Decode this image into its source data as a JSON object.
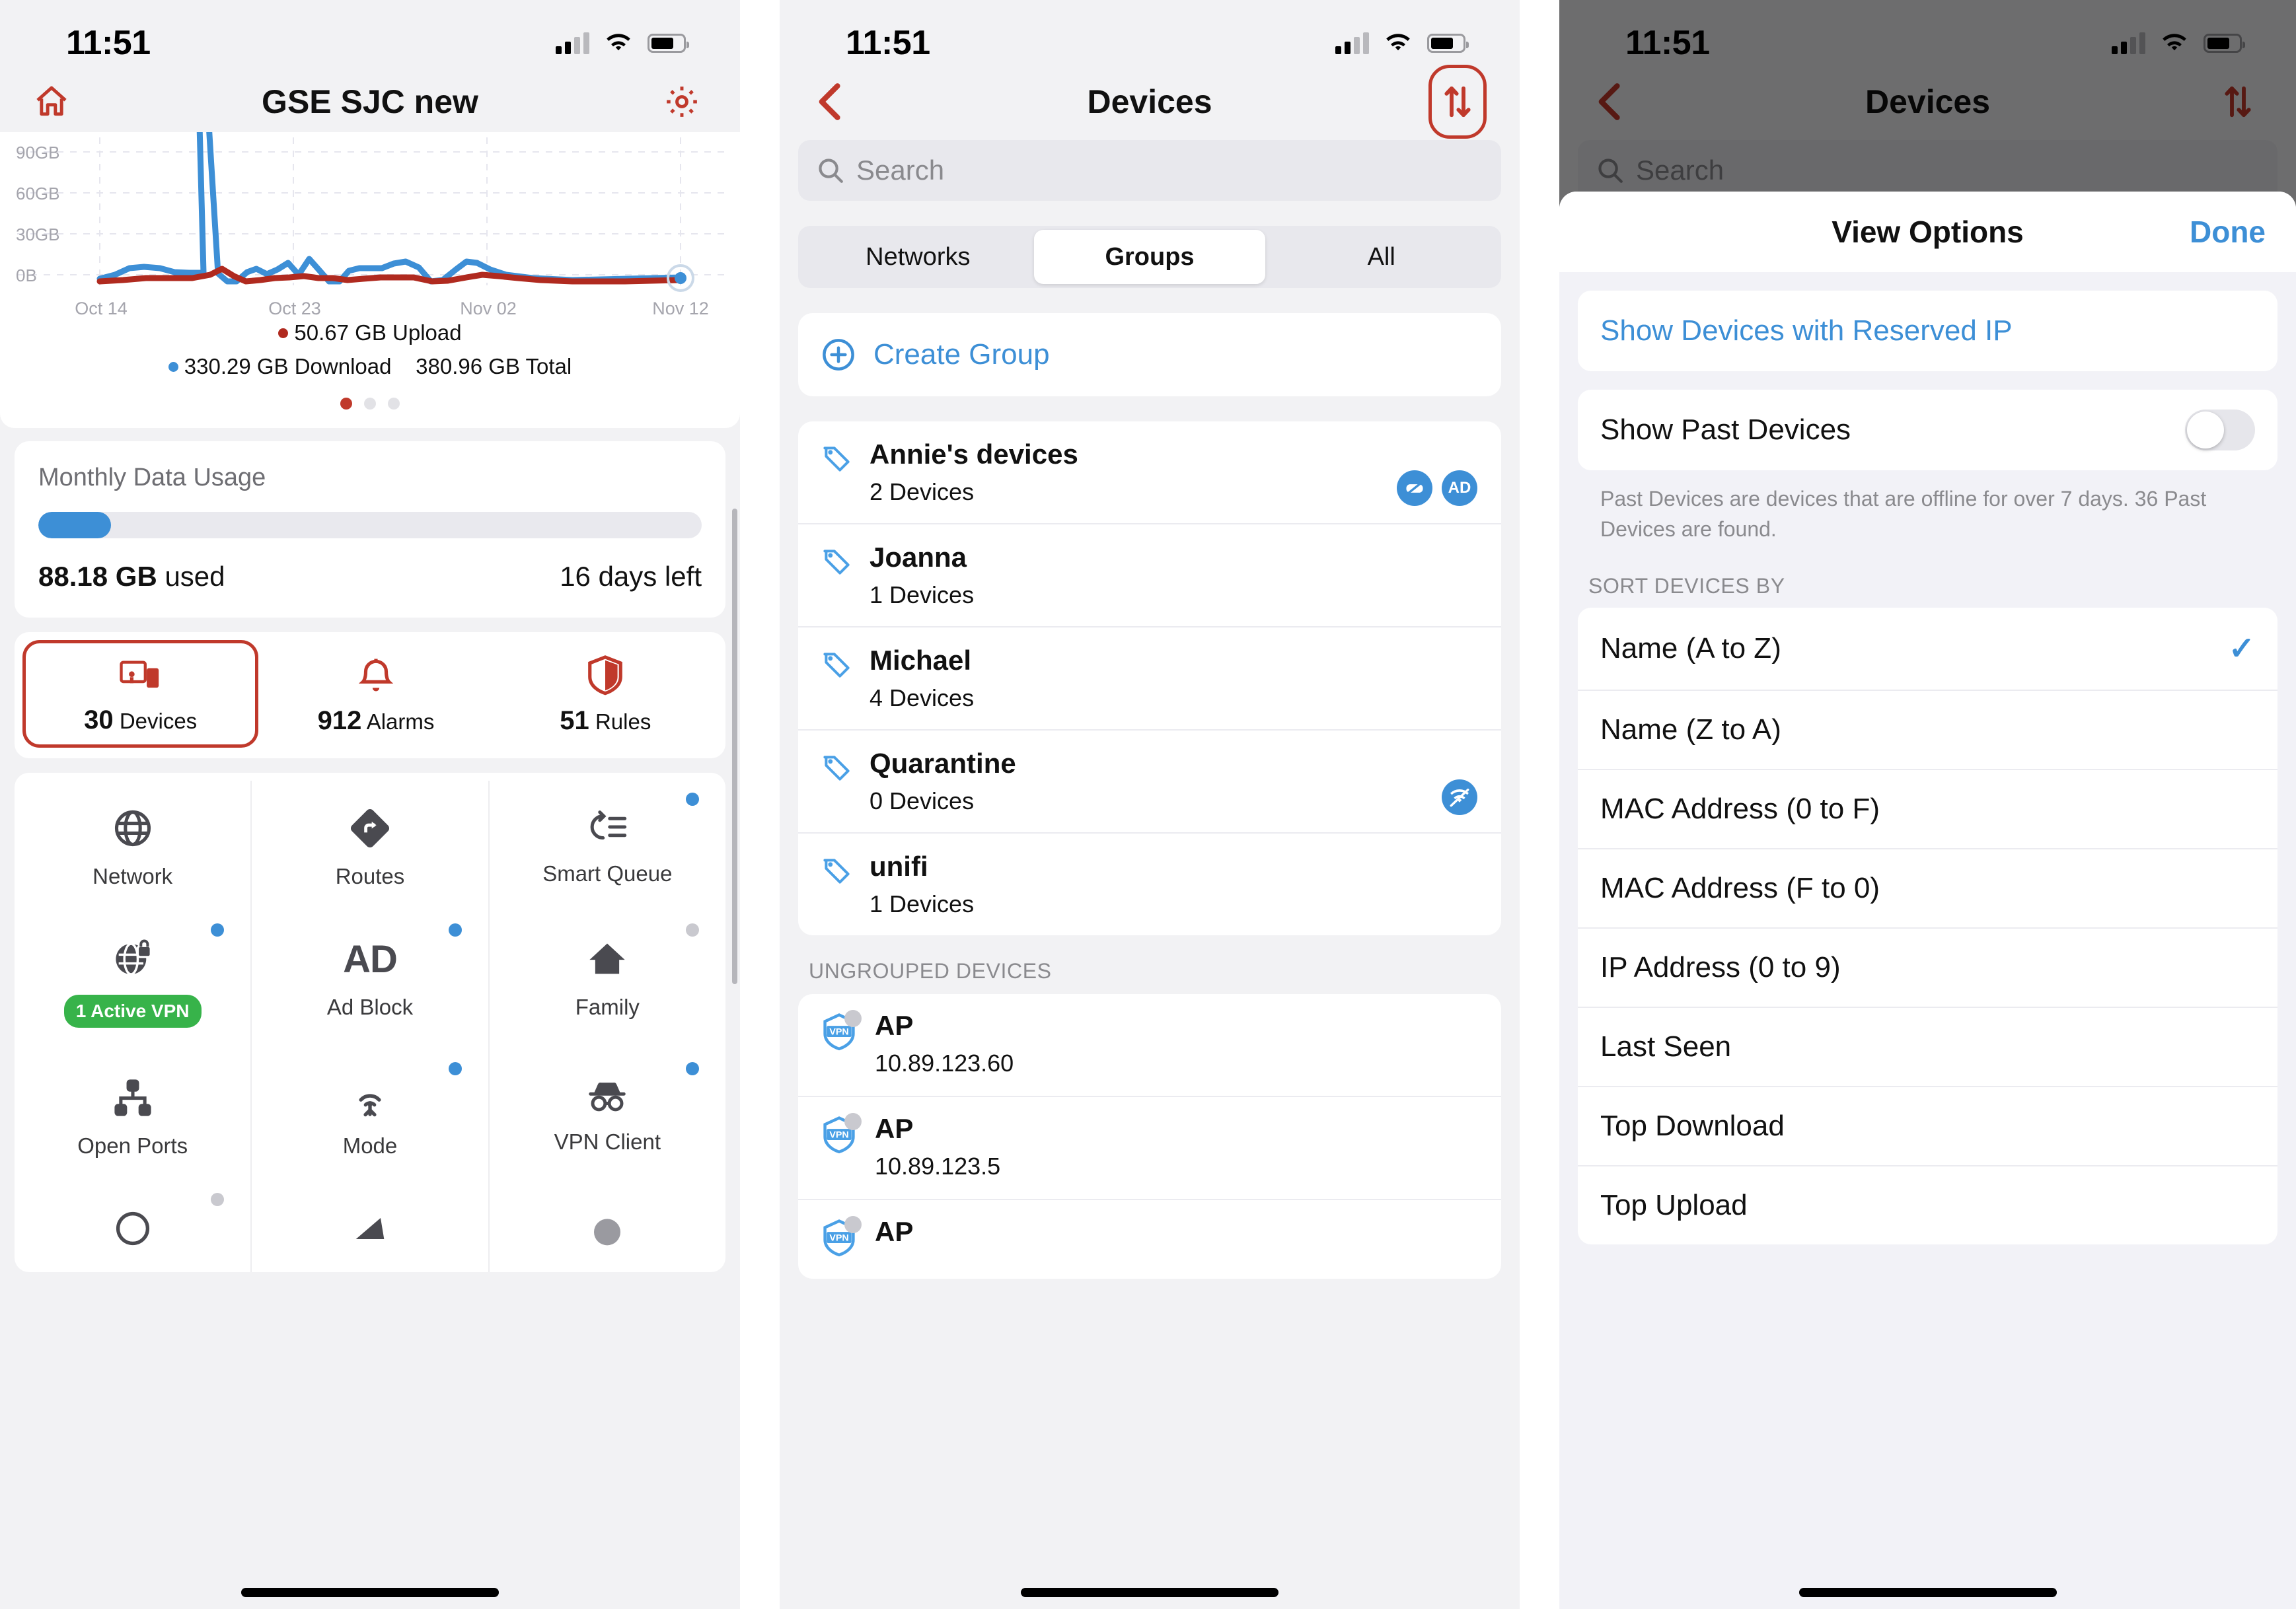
{
  "status_bar": {
    "time": "11:51"
  },
  "panel1": {
    "nav": {
      "home_icon": "home-icon",
      "title": "GSE SJC new",
      "settings_icon": "gear-icon"
    },
    "chart_card": {
      "legend_upload": "50.67 GB Upload",
      "legend_download": "330.29 GB Download",
      "legend_total": "380.96 GB Total",
      "pager_count": 3,
      "pager_active": 0
    },
    "usage": {
      "title": "Monthly Data Usage",
      "used_value": "88.18 GB",
      "used_suffix": "used",
      "days_left": "16 days left",
      "percent": 11
    },
    "stats": [
      {
        "value": "30",
        "label": "Devices",
        "icon": "devices-icon",
        "selected": true
      },
      {
        "value": "912",
        "label": "Alarms",
        "icon": "bell-icon",
        "selected": false
      },
      {
        "value": "51",
        "label": "Rules",
        "icon": "shield-icon",
        "selected": false
      }
    ],
    "grid": [
      {
        "label": "Network",
        "icon": "globe-icon",
        "badge": "none"
      },
      {
        "label": "Routes",
        "icon": "routes-icon",
        "badge": "none"
      },
      {
        "label": "Smart Queue",
        "icon": "smart-queue-icon",
        "badge": "blue"
      },
      {
        "label": "1 Active VPN",
        "icon": "vpn-server-icon",
        "badge": "blue",
        "pill": true
      },
      {
        "label": "Ad Block",
        "icon": "ad-icon",
        "badge": "blue"
      },
      {
        "label": "Family",
        "icon": "home-filled-icon",
        "badge": "grey"
      },
      {
        "label": "Open Ports",
        "icon": "open-ports-icon",
        "badge": "none"
      },
      {
        "label": "Mode",
        "icon": "antenna-icon",
        "badge": "blue"
      },
      {
        "label": "VPN Client",
        "icon": "incognito-icon",
        "badge": "blue"
      }
    ]
  },
  "panel2": {
    "nav": {
      "back_icon": "chevron-left-icon",
      "title": "Devices",
      "sort_icon": "sort-updown-icon"
    },
    "search": {
      "placeholder": "Search",
      "value": "",
      "icon": "search-icon"
    },
    "segments": [
      {
        "label": "Networks",
        "selected": false
      },
      {
        "label": "Groups",
        "selected": true
      },
      {
        "label": "All",
        "selected": false
      }
    ],
    "create_group": {
      "label": "Create Group",
      "icon": "plus-circle-icon"
    },
    "groups": [
      {
        "name": "Annie's devices",
        "count": "2 Devices",
        "chips": [
          "no-gaming-icon",
          "AD"
        ]
      },
      {
        "name": "Joanna",
        "count": "1 Devices",
        "chips": []
      },
      {
        "name": "Michael",
        "count": "4 Devices",
        "chips": []
      },
      {
        "name": "Quarantine",
        "count": "0 Devices",
        "chips": [
          "wifi-off-icon"
        ]
      },
      {
        "name": "unifi",
        "count": "1 Devices",
        "chips": []
      }
    ],
    "ungrouped_header": "UNGROUPED DEVICES",
    "ungrouped": [
      {
        "name": "AP",
        "ip": "10.89.123.60",
        "icon": "vpn-shield-icon",
        "offline": true
      },
      {
        "name": "AP",
        "ip": "10.89.123.5",
        "icon": "vpn-shield-icon",
        "offline": true
      }
    ]
  },
  "panel3": {
    "nav": {
      "back_icon": "chevron-left-icon",
      "title": "Devices",
      "sort_icon": "sort-updown-icon"
    },
    "search": {
      "placeholder": "Search",
      "value": "",
      "icon": "search-icon"
    },
    "sheet": {
      "title": "View Options",
      "done_label": "Done",
      "reserved_ip_label": "Show Devices with Reserved IP",
      "past_devices_label": "Show Past Devices",
      "past_devices_on": false,
      "past_devices_note": "Past Devices are devices that are offline for over 7 days. 36 Past Devices are found.",
      "sort_header": "SORT DEVICES BY",
      "sort_options": [
        {
          "label": "Name (A to Z)",
          "selected": true
        },
        {
          "label": "Name (Z to A)",
          "selected": false
        },
        {
          "label": "MAC Address (0 to F)",
          "selected": false
        },
        {
          "label": "MAC Address (F to 0)",
          "selected": false
        },
        {
          "label": "IP Address (0 to 9)",
          "selected": false
        },
        {
          "label": "Last Seen",
          "selected": false
        },
        {
          "label": "Top Download",
          "selected": false
        },
        {
          "label": "Top Upload",
          "selected": false
        }
      ]
    }
  },
  "chart_data": {
    "type": "line",
    "title": "",
    "xlabel": "",
    "ylabel": "",
    "ylim": [
      0,
      105
    ],
    "yticks": [
      "0B",
      "30GB",
      "60GB",
      "90GB"
    ],
    "xticks": [
      "Oct 14",
      "Oct 23",
      "Nov 02",
      "Nov 12"
    ],
    "grid": true,
    "legend_position": "bottom",
    "series": [
      {
        "name": "Download",
        "color": "#3d8fd6",
        "values": [
          1,
          3,
          7,
          8,
          7,
          5,
          4,
          4,
          5,
          100,
          102,
          40,
          2,
          1,
          5,
          6,
          4,
          5,
          9,
          4,
          11,
          6,
          1,
          1,
          5,
          6,
          6,
          6,
          8,
          9,
          6,
          1,
          2,
          7,
          11,
          10,
          5,
          3,
          2,
          2,
          3
        ]
      },
      {
        "name": "Upload",
        "color": "#b02a1f",
        "values": [
          0.5,
          1,
          2,
          2,
          2,
          2,
          2,
          2,
          3,
          5,
          3,
          1,
          1,
          1,
          2,
          2,
          2,
          3,
          2,
          2,
          2,
          2,
          1,
          1,
          2,
          2,
          2,
          2,
          2,
          2,
          2,
          1,
          1,
          2,
          3,
          2,
          2,
          1,
          1,
          1,
          1
        ]
      }
    ],
    "annotations": {
      "upload_total": "50.67 GB Upload",
      "download_total": "330.29 GB Download",
      "grand_total": "380.96 GB Total"
    }
  }
}
